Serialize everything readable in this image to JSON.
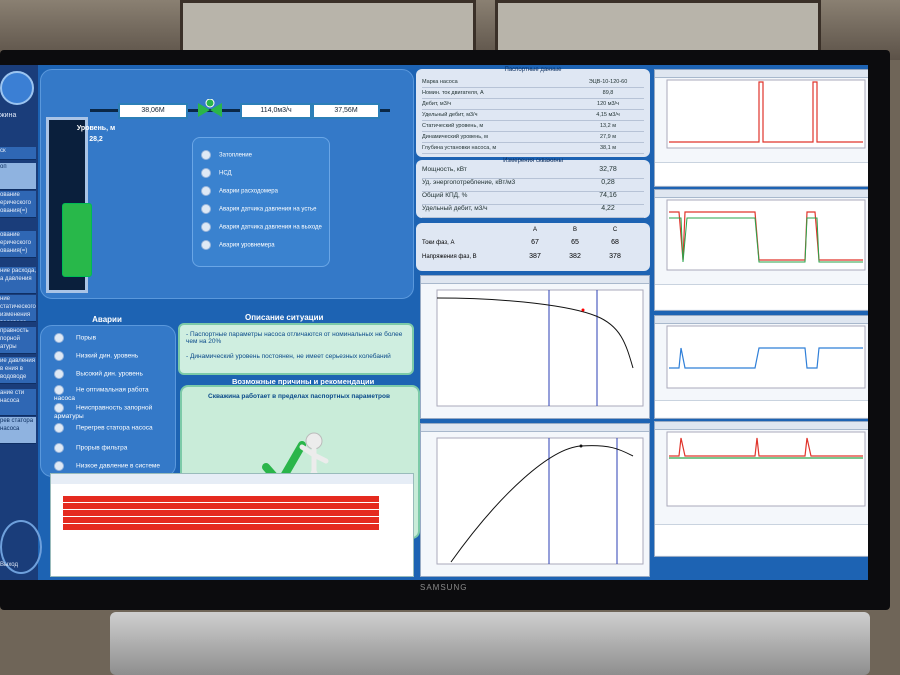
{
  "main_values": {
    "level_label": "Уровень, м",
    "level_value": "28,2",
    "flow1": "38,06М",
    "flow2": "114,0м3/ч",
    "flow3": "37,56М"
  },
  "status_lamps": [
    "Затопление",
    "НСД",
    "Аварии расходомера",
    "Авария датчика давления на устье",
    "Авария датчика давления на выходе",
    "Авария уровнемера"
  ],
  "alarms": {
    "title": "Аварии",
    "items": [
      "Порыв",
      "Низкий дин. уровень",
      "Высокий дин. уровень",
      "Не оптимальная работа насоса",
      "Неисправность запорной арматуры",
      "Перегрев статора насоса",
      "Прорыв фильтра",
      "Низкое давление в системе"
    ]
  },
  "situation": {
    "title": "Описание ситуации",
    "line1": "- Паспортные параметры насоса отличаются от номинальных не более чем на 20%",
    "line2": "- Динамический уровень постоянен, не имеет серьезных колебаний"
  },
  "recommendation": {
    "title": "Возможные причины и рекомендации",
    "text": "Скважина работает в пределах паспортных параметров"
  },
  "passport": {
    "title": "Паспортные данные",
    "rows": [
      {
        "label": "Марка насоса",
        "value": "ЭЦВ-10-120-60"
      },
      {
        "label": "Номин. ток двигателя, А",
        "value": "89,8"
      },
      {
        "label": "Дебит, м3/ч",
        "value": "120 м3/ч"
      },
      {
        "label": "Удельный дебит, м3/ч",
        "value": "4,15 м3/ч"
      },
      {
        "label": "Статический уровень, м",
        "value": "13,2 м"
      },
      {
        "label": "Динамический уровень, м",
        "value": "27,9 м"
      },
      {
        "label": "Глубина установки насоса, м",
        "value": "38,1 м"
      }
    ]
  },
  "measured": {
    "title": "Измерения скважины",
    "rows": [
      {
        "label": "Мощность, кВт",
        "value": "32,78"
      },
      {
        "label": "Уд. энергопотребление, кВт/м3",
        "value": "0,28"
      },
      {
        "label": "Общий КПД, %",
        "value": "74,16"
      },
      {
        "label": "Удельный дебит, м3/ч",
        "value": "4,22"
      }
    ]
  },
  "phases": {
    "headers": [
      "A",
      "B",
      "C"
    ],
    "currents_label": "Токи фаз, А",
    "currents": [
      "67",
      "65",
      "68"
    ],
    "voltages_label": "Напряжения фаз, В",
    "voltages": [
      "387",
      "382",
      "378"
    ]
  },
  "sidebar": {
    "logo_text": "жина",
    "back_label": "ск",
    "items": [
      "оп",
      "ование ерического ования(=)",
      "ование ерического ования(=)",
      "ние расхода, а давления",
      "ние статического изменения водовода",
      "правность порной атуры",
      "ие давления в ения в водоводе",
      "ание сти насоса",
      "рев статора насоса"
    ],
    "exit_label": "Выход"
  },
  "colors": {
    "alarm_red": "#e52a1f",
    "screen_blue": "#1d63b3",
    "ok_green": "#2ab54a"
  }
}
